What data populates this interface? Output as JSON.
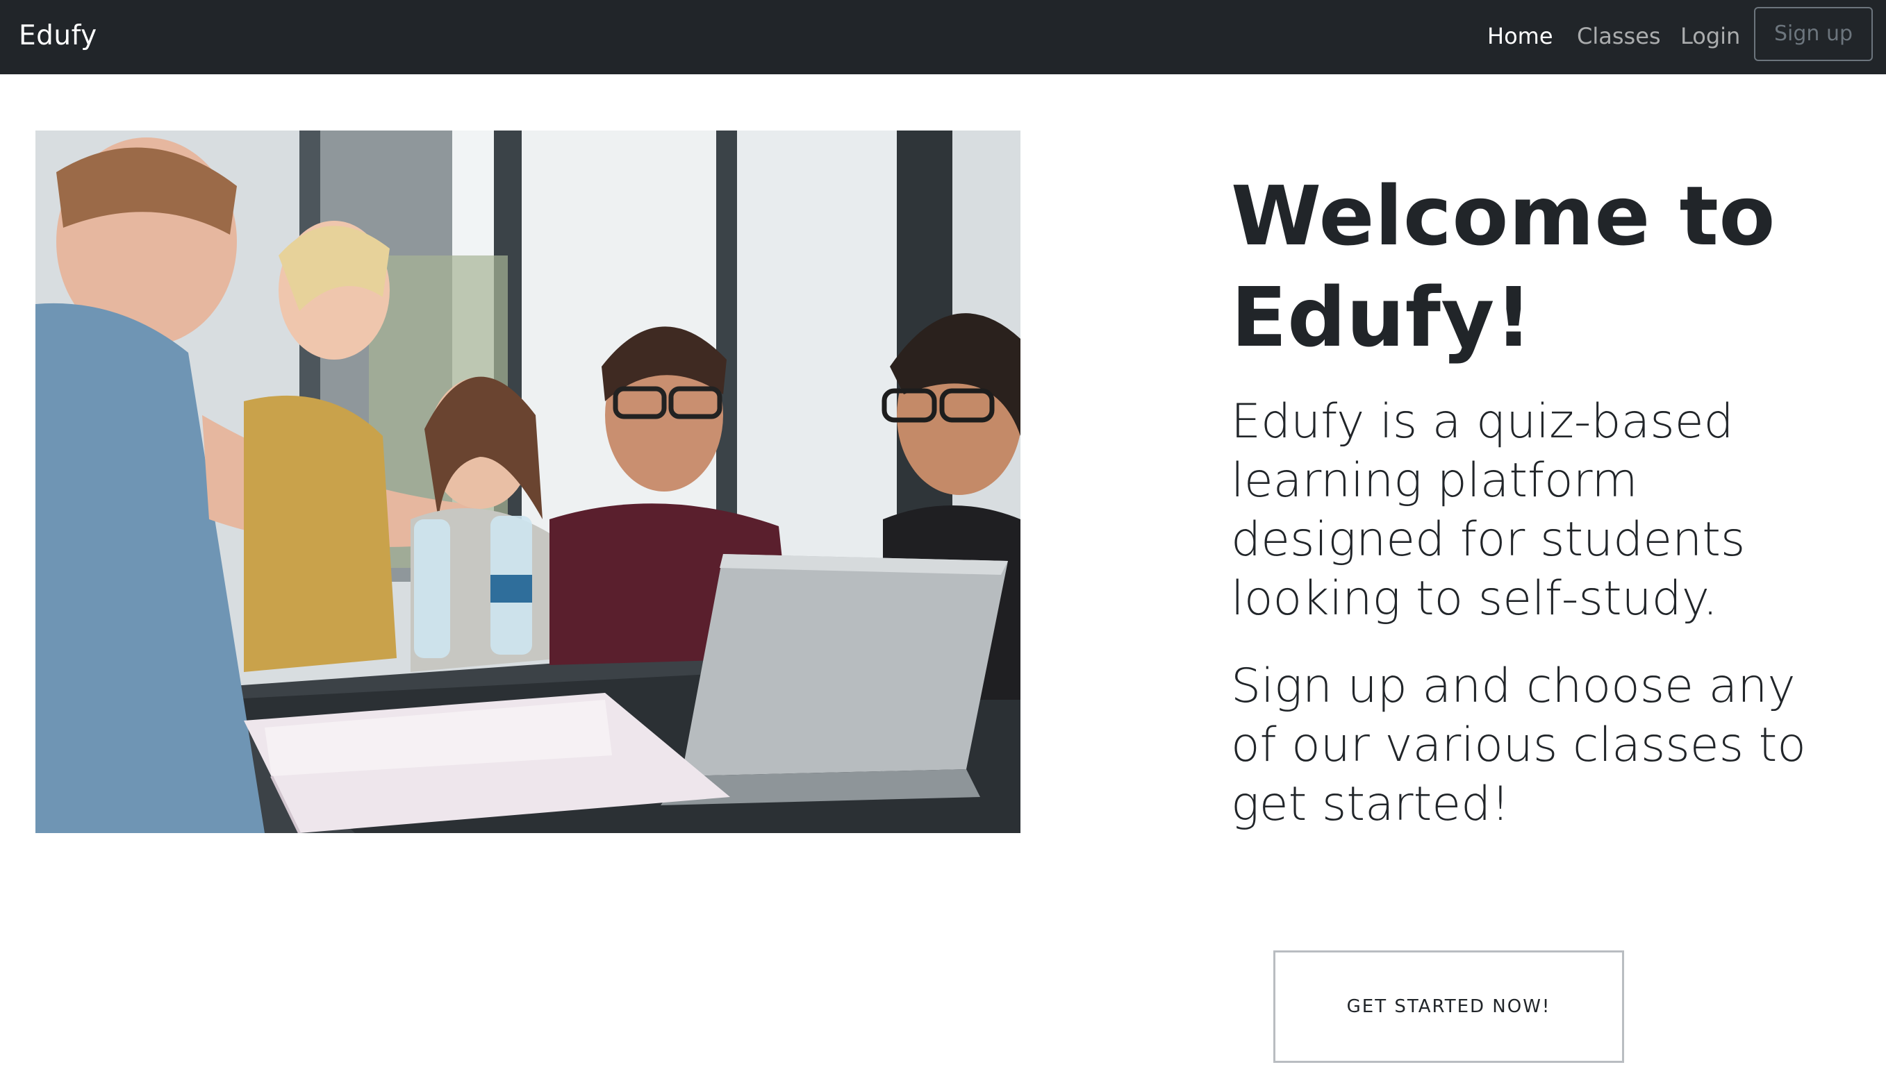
{
  "navbar": {
    "brand": "Edufy",
    "links": [
      {
        "label": "Home",
        "active": true
      },
      {
        "label": "Classes",
        "active": false
      },
      {
        "label": "Login",
        "active": false
      }
    ],
    "signup_label": "Sign up",
    "background_color": "#212529"
  },
  "hero": {
    "image_alt": "Group of students studying together around a laptop",
    "title": "Welcome to Edufy!",
    "lead_1": "Edufy is a quiz-based learning platform designed for students looking to self-study.",
    "lead_2": "Sign up and choose any of our various classes to get started!",
    "cta_label": "GET STARTED NOW!"
  }
}
